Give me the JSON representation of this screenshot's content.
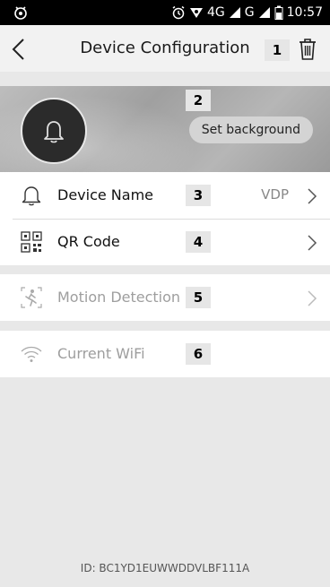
{
  "status_bar": {
    "network_text": "4G",
    "network_text2": "G",
    "time": "10:57"
  },
  "header": {
    "title": "Device Configuration",
    "back_icon": "chevron-left-icon",
    "delete_icon": "trash-icon"
  },
  "markers": [
    "1",
    "2",
    "3",
    "4",
    "5",
    "6"
  ],
  "banner": {
    "avatar_icon": "bell-icon",
    "set_background_label": "Set background"
  },
  "settings": {
    "device_name": {
      "label": "Device Name",
      "value": "VDP",
      "icon": "bell-outline-icon"
    },
    "qr_code": {
      "label": "QR Code",
      "icon": "qr-code-icon"
    },
    "motion_detection": {
      "label": "Motion Detection",
      "icon": "motion-icon",
      "enabled": false
    },
    "current_wifi": {
      "label": "Current WiFi",
      "icon": "wifi-icon",
      "enabled": false
    }
  },
  "footer": {
    "device_id": "ID: BC1YD1EUWWDDVLBF111A"
  },
  "colors": {
    "status_bar_bg": "#000000",
    "header_bg": "#f2f2f2",
    "page_bg": "#e8e8e8",
    "disabled_text": "#9e9e9e"
  }
}
